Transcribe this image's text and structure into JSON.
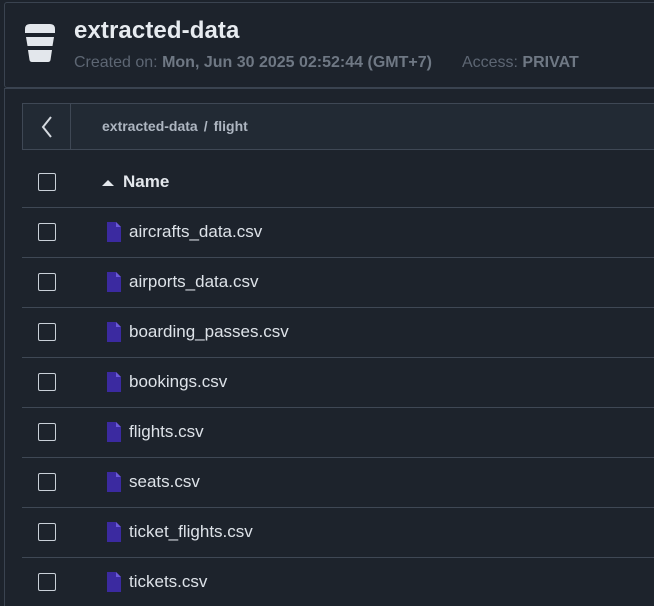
{
  "header": {
    "bucket_name": "extracted-data",
    "created_label": "Created on:",
    "created_value": "Mon, Jun 30 2025 02:52:44 (GMT+7)",
    "access_label": "Access:",
    "access_value": "PRIVAT"
  },
  "breadcrumb": {
    "items": [
      "extracted-data",
      "flight"
    ],
    "separator": "/"
  },
  "table": {
    "name_header": "Name",
    "sort": "ascending",
    "files": [
      {
        "name": "aircrafts_data.csv"
      },
      {
        "name": "airports_data.csv"
      },
      {
        "name": "boarding_passes.csv"
      },
      {
        "name": "bookings.csv"
      },
      {
        "name": "flights.csv"
      },
      {
        "name": "seats.csv"
      },
      {
        "name": "ticket_flights.csv"
      },
      {
        "name": "tickets.csv"
      }
    ]
  },
  "colors": {
    "background": "#1d232c",
    "file_icon": "#3b2aa0",
    "border": "#3f4855"
  },
  "icons": {
    "bucket": "bucket-icon",
    "back": "chevron-left-icon",
    "sort": "sort-up-icon",
    "file": "file-icon"
  }
}
